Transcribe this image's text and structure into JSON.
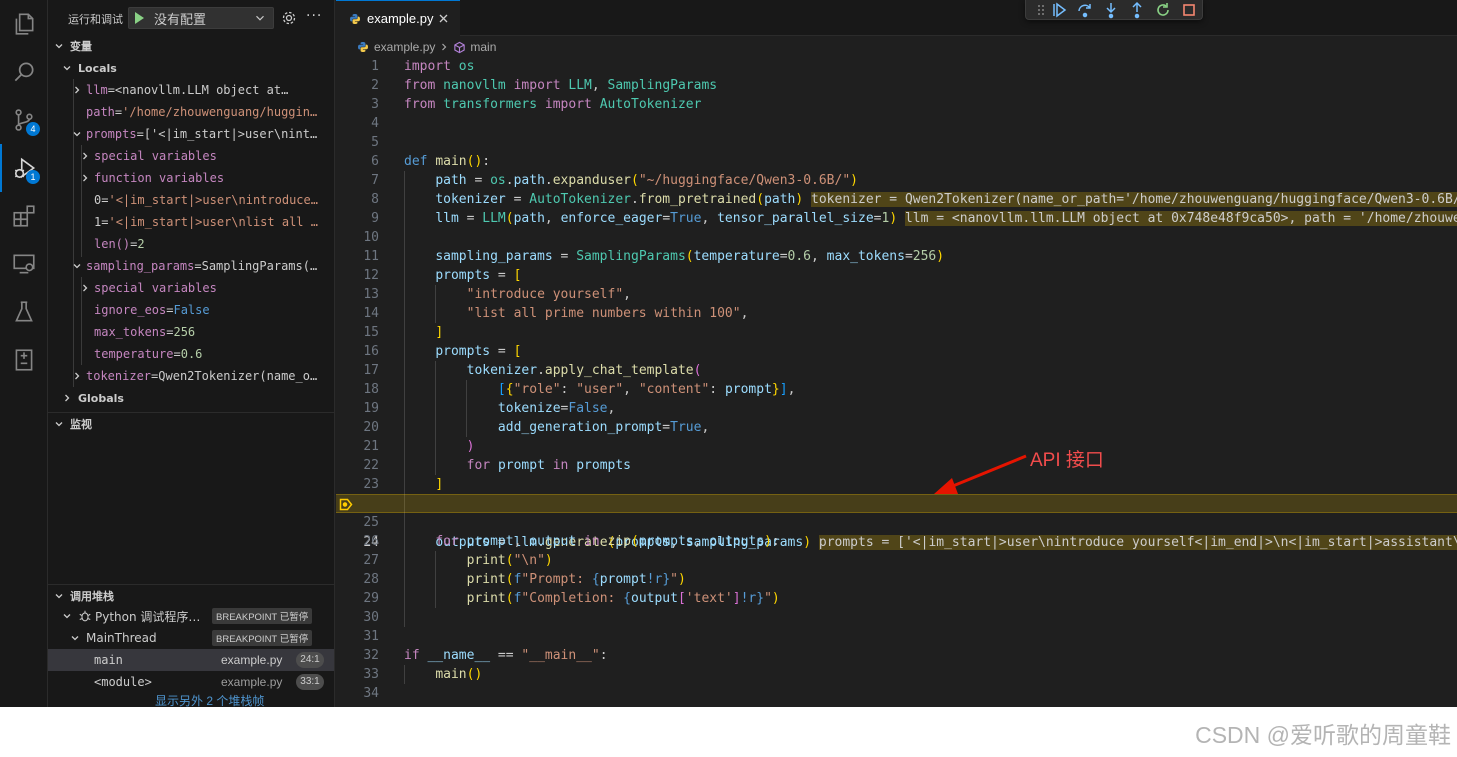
{
  "activity_bar": {
    "scm_badge": "4",
    "debug_badge": "1"
  },
  "run_debug": {
    "title": "运行和调试",
    "config": "没有配置"
  },
  "variables": {
    "section_title": "变量",
    "locals_title": "Locals",
    "globals_title": "Globals",
    "rows": [
      {
        "name": "llm",
        "value": "<nanovllm.LLM object at…"
      },
      {
        "name": "path",
        "value": "'/home/zhouwenguang/huggin…"
      },
      {
        "name": "prompts",
        "value": "['<|im_start|>user\\nint…"
      },
      {
        "name": "special variables",
        "value": ""
      },
      {
        "name": "function variables",
        "value": ""
      },
      {
        "name": "0",
        "value": "'<|im_start|>user\\nintroduce…"
      },
      {
        "name": "1",
        "value": "'<|im_start|>user\\nlist all …"
      },
      {
        "name": "len()",
        "value": "2"
      },
      {
        "name": "sampling_params",
        "value": "SamplingParams(…"
      },
      {
        "name": "special variables",
        "value": ""
      },
      {
        "name": "ignore_eos",
        "value": "False"
      },
      {
        "name": "max_tokens",
        "value": "256"
      },
      {
        "name": "temperature",
        "value": "0.6"
      },
      {
        "name": "tokenizer",
        "value": "Qwen2Tokenizer(name_o…"
      }
    ]
  },
  "watch": {
    "section_title": "监视"
  },
  "callstack": {
    "section_title": "调用堆栈",
    "session": "Python 调试程序…",
    "session_state": "BREAKPOINT 已暂停",
    "thread": "MainThread",
    "thread_state": "BREAKPOINT 已暂停",
    "frames": [
      {
        "name": "main",
        "file": "example.py",
        "pos": "24:1"
      },
      {
        "name": "<module>",
        "file": "example.py",
        "pos": "33:1"
      }
    ],
    "more_frames": "显示另外 2 个堆栈帧"
  },
  "editor": {
    "tab_label": "example.py",
    "breadcrumb_file": "example.py",
    "breadcrumb_symbol": "main",
    "current_line": "24",
    "inline_values": {
      "tokenizer": "tokenizer = Qwen2Tokenizer(name_or_path='/home/zhouwenguang/huggingface/Qwen3-0.6B/',",
      "llm": "llm = <nanovllm.llm.LLM object at 0x748e48f9ca50>, path = '/home/zhouweng",
      "prompts": "prompts = ['<|im_start|>user\\nintroduce yourself<|im_end|>\\n<|im_start|>assistant\\n'"
    },
    "line_numbers": [
      "1",
      "2",
      "3",
      "4",
      "5",
      "6",
      "7",
      "8",
      "9",
      "10",
      "11",
      "12",
      "13",
      "14",
      "15",
      "16",
      "17",
      "18",
      "19",
      "20",
      "21",
      "22",
      "23",
      "24",
      "25",
      "26",
      "27",
      "28",
      "29",
      "30",
      "31",
      "32",
      "33",
      "34"
    ]
  },
  "annotation": {
    "text": "API 接口"
  },
  "watermark": "CSDN @爱听歌的周童鞋"
}
